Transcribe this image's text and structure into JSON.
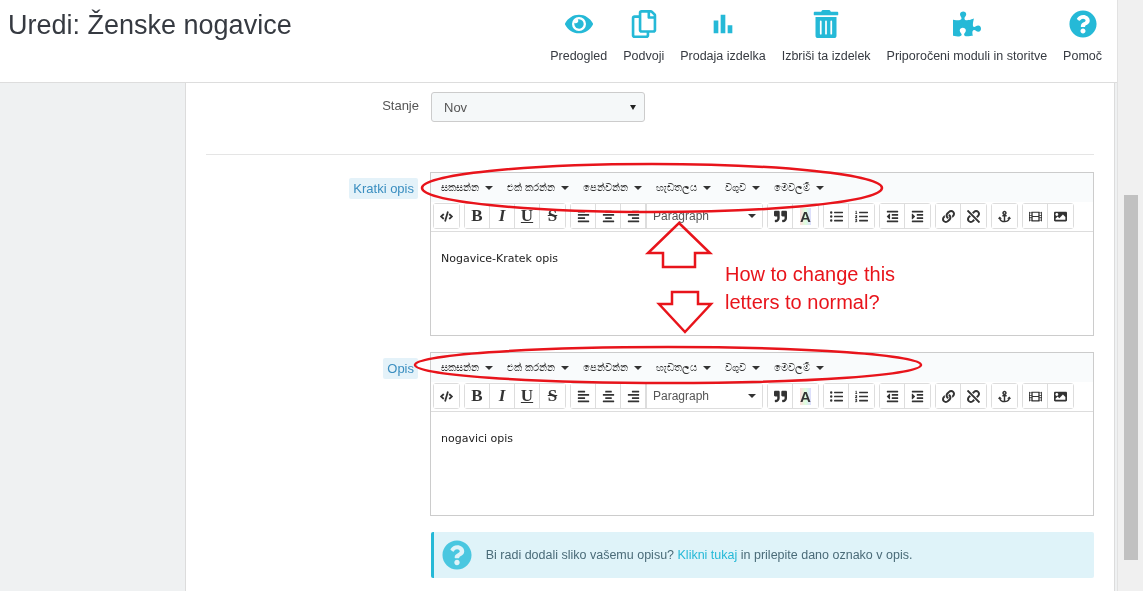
{
  "page_title": "Uredi: Ženske nogavice",
  "toolbar_actions": [
    {
      "label": "Predogled"
    },
    {
      "label": "Podvoji"
    },
    {
      "label": "Prodaja izdelka"
    },
    {
      "label": "Izbriši ta izdelek"
    },
    {
      "label": "Priporočeni moduli in storitve"
    },
    {
      "label": "Pomoč"
    }
  ],
  "condition": {
    "label": "Stanje",
    "value": "Nov"
  },
  "editors": [
    {
      "label": "Kratki opis",
      "menus": [
        "සකසන්න",
        "එක් කරන්න",
        "පෙන්වන්න",
        "හැඩතලය",
        "වගුව",
        "මෙවලම්"
      ],
      "format_buttons": [
        "B",
        "I",
        "U",
        "S"
      ],
      "block_format": "Paragraph",
      "text_color_label": "A",
      "content": "Nogavice-Kratek opis"
    },
    {
      "label": "Opis",
      "menus": [
        "සකසන්න",
        "එක් කරන්න",
        "පෙන්වන්න",
        "හැඩතලය",
        "වගුව",
        "මෙවලම්"
      ],
      "format_buttons": [
        "B",
        "I",
        "U",
        "S"
      ],
      "block_format": "Paragraph",
      "text_color_label": "A",
      "content": "nogavici opis"
    }
  ],
  "info": {
    "text": "Bi radi dodali sliko vašemu opisu?",
    "link": "Klikni tukaj",
    "after": "in prilepite dano oznako v opis."
  },
  "annotation": {
    "text": "How to change this letters to normal?"
  }
}
